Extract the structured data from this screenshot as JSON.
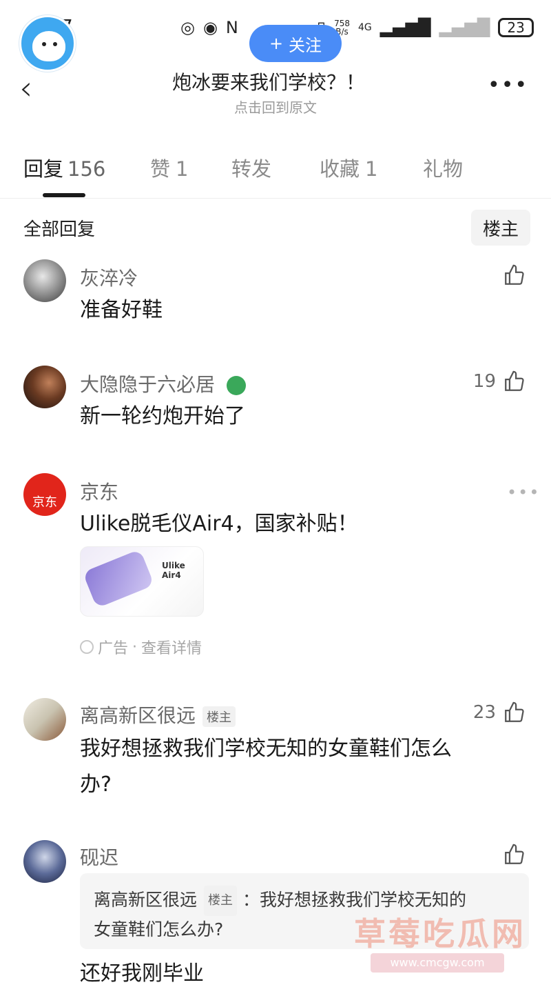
{
  "status_bar": {
    "time": "7",
    "net_speed_value": "758",
    "net_speed_unit": "B/s",
    "network": "4G",
    "battery": "23"
  },
  "follow_button": {
    "label": "关注",
    "plus": "+"
  },
  "nav": {
    "title": "炮冰要来我们学校？！",
    "subtitle": "点击回到原文",
    "back": "‹",
    "more": "•••"
  },
  "tabs": [
    {
      "label": "回复",
      "count": "156"
    },
    {
      "label": "赞",
      "count": "1"
    },
    {
      "label": "转发",
      "count": ""
    },
    {
      "label": "收藏",
      "count": "1"
    },
    {
      "label": "礼物",
      "count": ""
    }
  ],
  "section_label": "全部回复",
  "owner_filter": "楼主",
  "comments": [
    {
      "user": "灰淬冷",
      "text": "准备好鞋",
      "likes": ""
    },
    {
      "user": "大隐隐于六必居",
      "text": "新一轮约炮开始了",
      "likes": "19"
    },
    {
      "user": "京东",
      "text": "Ulike脱毛仪Air4，国家补贴！",
      "ad_label": "广告",
      "ad_link": "查看详情",
      "ad_brand": "Ulike Air4",
      "avatar_text": "京东"
    },
    {
      "user": "离高新区很远",
      "badge": "楼主",
      "text_line1": "我好想拯救我们学校无知的女童鞋们怎么",
      "text_line2": "办?",
      "likes": "23"
    },
    {
      "user": "砚迟",
      "quote_user": "离高新区很远",
      "quote_badge": "楼主",
      "quote_line1": "：我好想拯救我们学校无知的",
      "quote_line2": "女童鞋们怎么办?",
      "text": "还好我刚毕业",
      "likes": ""
    }
  ],
  "watermark": {
    "text": "草莓吃瓜网",
    "url": "www.cmcgw.com"
  }
}
